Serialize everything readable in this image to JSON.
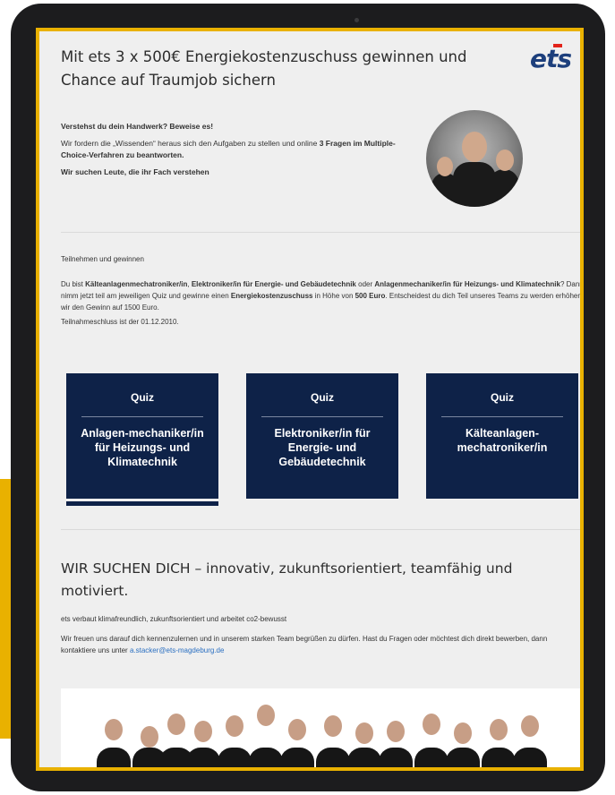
{
  "page": {
    "headline": "Mit ets 3 x 500€ Energiekostenzuschuss gewinnen und Chance auf Traumjob sichern",
    "logo_text": "ets"
  },
  "intro": {
    "heading": "Verstehst du dein Handwerk? Beweise es!",
    "text_part1": "Wir fordern die „Wissenden“ heraus sich den Aufgaben zu stellen und online ",
    "text_bold": "3 Fragen im Multiple-Choice-Verfahren zu beantworten.",
    "closing": "Wir suchen Leute, die ihr Fach verstehen"
  },
  "participate": {
    "heading": "Teilnehmen und gewinnen",
    "t1": "Du bist ",
    "b1": "Kälteanlagenmechatroniker/in",
    "t2": ", ",
    "b2": "Elektroniker/in für Energie- und Gebäudetechnik",
    "t3": " oder ",
    "b3": "Anlagenmechaniker/in für Heizungs- und Klimatechnik",
    "t4": "? Dann nimm jetzt teil am jeweiligen Quiz und gewinne einen ",
    "b4": "Energiekostenzuschuss",
    "t5": " in Höhe von ",
    "b5": "500 Euro",
    "t6": ". Entscheidest du dich Teil unseres Teams zu werden erhöhen wir den Gewinn auf 1500 Euro.",
    "deadline": "Teilnahmeschluss ist der 01.12.2010."
  },
  "quizzes": [
    {
      "title": "Quiz",
      "label": "Anlagen-mechaniker/in für Heizungs- und Klimatechnik"
    },
    {
      "title": "Quiz",
      "label": "Elektroniker/in für Energie- und Gebäudetechnik"
    },
    {
      "title": "Quiz",
      "label": "Kälteanlagen-mechatroniker/in"
    }
  ],
  "section2": {
    "title": "WIR SUCHEN DICH – innovativ, zukunftsorientiert, teamfähig und motiviert.",
    "line1": "ets verbaut klimafreundlich, zukunftsorientiert und arbeitet co2-bewusst",
    "text": "Wir freuen uns darauf dich kennenzulernen und in unserem starken Team begrüßen zu dürfen. Hast du Fragen oder möchtest dich direkt bewerben, dann kontaktiere uns unter ",
    "email": "a.stacker@ets-magdeburg.de"
  },
  "colors": {
    "accent_yellow": "#e9b100",
    "navy": "#0e2248",
    "brand_blue": "#1d3f7c",
    "link": "#2a6fc1"
  }
}
